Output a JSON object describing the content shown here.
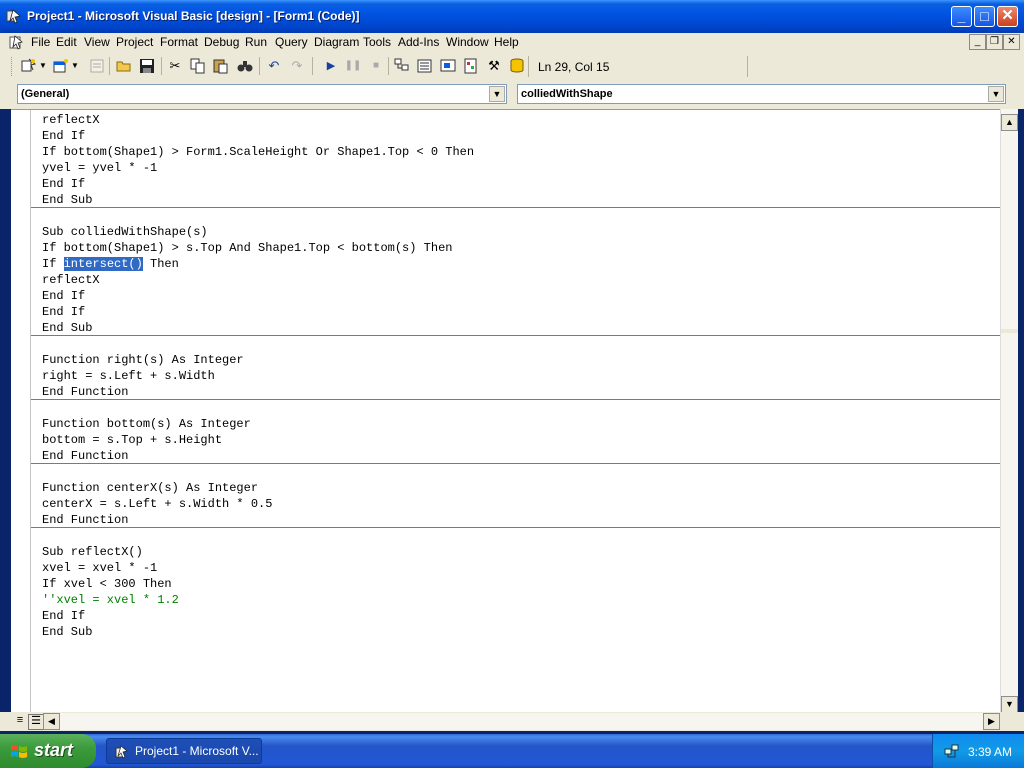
{
  "window": {
    "title": "Project1 - Microsoft Visual Basic [design] - [Form1 (Code)]",
    "buttons": {
      "minimize": "_",
      "maximize": "□",
      "close": "✕"
    }
  },
  "menu": {
    "items": [
      "File",
      "Edit",
      "View",
      "Project",
      "Format",
      "Debug",
      "Run",
      "Query",
      "Diagram",
      "Tools",
      "Add-Ins",
      "Window",
      "Help"
    ]
  },
  "toolbar": {
    "cursor_position": "Ln 29, Col 15",
    "icons": [
      "add-project-icon",
      "add-form-icon",
      "menu-editor-icon",
      "open-icon",
      "save-icon",
      "cut-icon",
      "copy-icon",
      "paste-icon",
      "find-icon",
      "undo-icon",
      "redo-icon",
      "start-icon",
      "break-icon",
      "end-icon",
      "project-explorer-icon",
      "properties-icon",
      "form-layout-icon",
      "object-browser-icon",
      "toolbox-icon",
      "data-view-icon"
    ]
  },
  "object_combo": {
    "value": "(General)"
  },
  "procedure_combo": {
    "value": "colliedWithShape"
  },
  "code": {
    "lines": [
      "reflectX",
      "End If",
      "If bottom(Shape1) > Form1.ScaleHeight Or Shape1.Top < 0 Then",
      "yvel = yvel * -1",
      "End If",
      "End Sub",
      "",
      "Sub colliedWithShape(s)",
      "If bottom(Shape1) > s.Top And Shape1.Top < bottom(s) Then",
      "If ",
      "reflectX",
      "End If",
      "End If",
      "End Sub",
      "",
      "Function right(s) As Integer",
      "right = s.Left + s.Width",
      "End Function",
      "",
      "Function bottom(s) As Integer",
      "bottom = s.Top + s.Height",
      "End Function",
      "",
      "Function centerX(s) As Integer",
      "centerX = s.Left + s.Width * 0.5",
      "End Function",
      "",
      "Sub reflectX()",
      "xvel = xvel * -1",
      "If xvel < 300 Then",
      "''xvel = xvel * 1.2",
      "End If",
      "End Sub"
    ],
    "selected_text": "intersect()",
    "after_selection": " Then"
  },
  "taskbar": {
    "start_label": "start",
    "task_label": "Project1 - Microsoft V...",
    "clock": "3:39 AM"
  }
}
